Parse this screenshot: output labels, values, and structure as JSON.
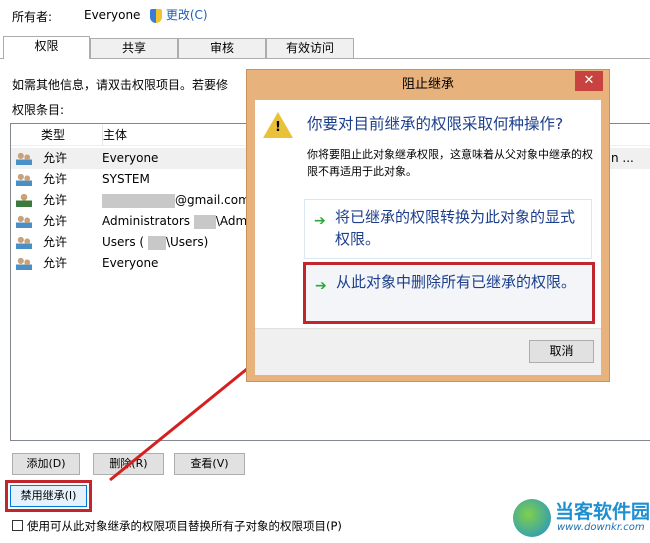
{
  "owner": {
    "label": "所有者:",
    "value": "Everyone",
    "change_link": "更改(C)"
  },
  "tabs": [
    {
      "label": "权限"
    },
    {
      "label": "共享"
    },
    {
      "label": "审核"
    },
    {
      "label": "有效访问"
    }
  ],
  "info_text": "如需其他信息，请双击权限项目。若要修",
  "entries_label": "权限条目:",
  "columns": {
    "type": "类型",
    "principal": "主体"
  },
  "rows": [
    {
      "type": "允许",
      "principal": "Everyone",
      "icon": "group-icon"
    },
    {
      "type": "允许",
      "principal": "SYSTEM",
      "icon": "group-icon"
    },
    {
      "type": "允许",
      "principal": "@gmail.com",
      "icon": "user-icon"
    },
    {
      "type": "允许",
      "principal": "Administrators",
      "suffix": "\\Admi",
      "icon": "group-icon"
    },
    {
      "type": "允许",
      "principal": "Users (",
      "suffix": "\\Users)",
      "icon": "group-icon"
    },
    {
      "type": "允许",
      "principal": "Everyone",
      "icon": "group-icon"
    }
  ],
  "row_overflow_text": "n ...",
  "buttons": {
    "add": "添加(D)",
    "remove": "删除(R)",
    "view": "查看(V)",
    "disable_inheritance": "禁用继承(I)"
  },
  "replace_checkbox": {
    "label": "使用可从此对象继承的权限项目替换所有子对象的权限项目(P)",
    "checked": false
  },
  "dialog": {
    "title": "阻止继承",
    "heading": "你要对目前继承的权限采取何种操作?",
    "description": "你将要阻止此对象继承权限，这意味着从父对象中继承的权限不再适用于此对象。",
    "option1": "将已继承的权限转换为此对象的显式权限。",
    "option2": "从此对象中删除所有已继承的权限。",
    "cancel": "取消"
  },
  "watermark": {
    "name": "当客软件园",
    "url": "www.downkr.com"
  },
  "colors": {
    "highlight": "#c0262b",
    "link": "#1c3f8c",
    "dialog_frame": "#e7b27b",
    "close": "#c8423f"
  }
}
